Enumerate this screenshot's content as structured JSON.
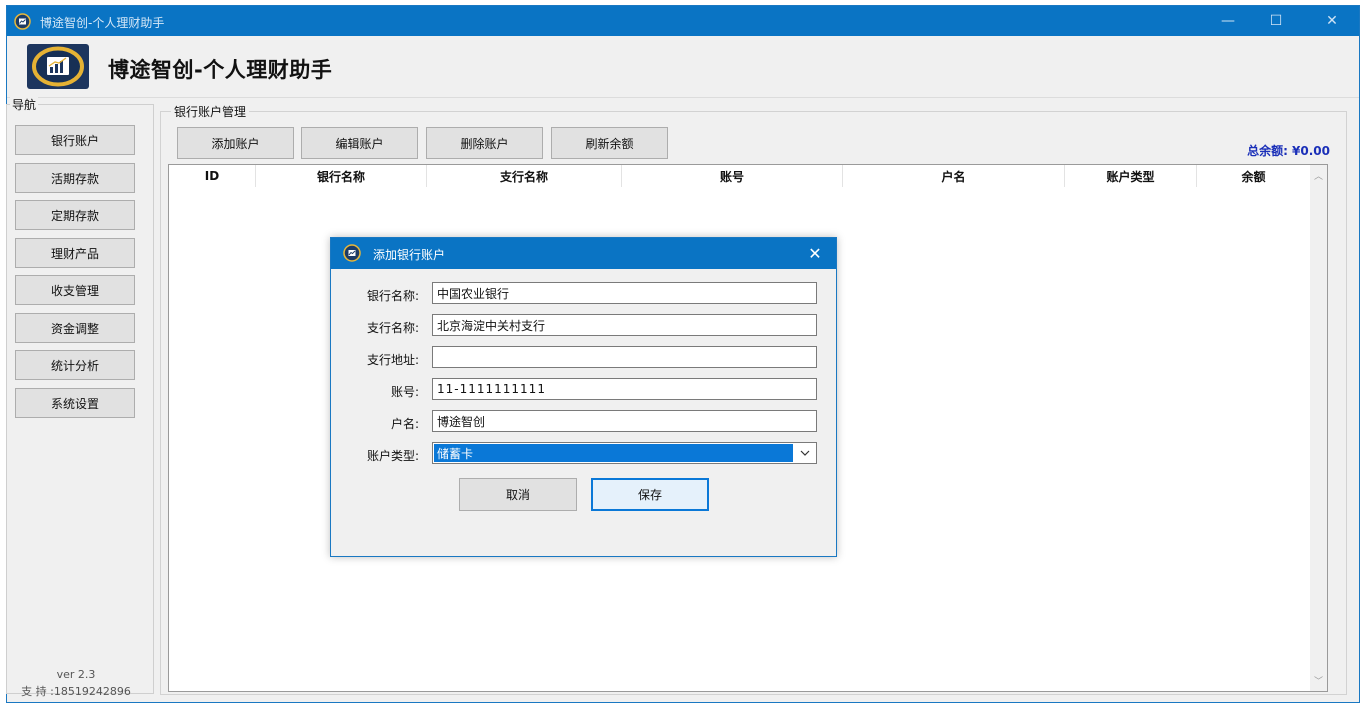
{
  "window": {
    "title": "博途智创-个人理财助手",
    "controls": {
      "minimize": "—",
      "maximize": "☐",
      "close": "✕"
    }
  },
  "header": {
    "app_name": "博途智创-个人理财助手"
  },
  "nav": {
    "legend": "导航",
    "items": [
      "银行账户",
      "活期存款",
      "定期存款",
      "理财产品",
      "收支管理",
      "资金调整",
      "统计分析",
      "系统设置"
    ],
    "version": "ver 2.3",
    "support": "支 持 :18519242896"
  },
  "main": {
    "legend": "银行账户管理",
    "toolbar": [
      "添加账户",
      "编辑账户",
      "删除账户",
      "刷新余额"
    ],
    "total": "总余额: ¥0.00",
    "columns": [
      "ID",
      "银行名称",
      "支行名称",
      "账号",
      "户名",
      "账户类型",
      "余额"
    ]
  },
  "dialog": {
    "title": "添加银行账户",
    "fields": {
      "bank_name": {
        "label": "银行名称:",
        "value": "中国农业银行"
      },
      "branch_name": {
        "label": "支行名称:",
        "value": "北京海淀中关村支行"
      },
      "branch_address": {
        "label": "支行地址:",
        "value": ""
      },
      "account_no": {
        "label": "账号:",
        "value": "11-1111111111"
      },
      "holder": {
        "label": "户名:",
        "value": "博途智创"
      },
      "account_type": {
        "label": "账户类型:",
        "value": "储蓄卡"
      }
    },
    "cancel": "取消",
    "save": "保存"
  },
  "colors": {
    "titlebar": "#0a74c4",
    "accent": "#0a78d7",
    "total_text": "#1a2fb8"
  },
  "icons": [
    "app-icon",
    "logo-icon",
    "close-icon",
    "chevron-down-icon",
    "scroll-up-icon",
    "scroll-down-icon"
  ]
}
